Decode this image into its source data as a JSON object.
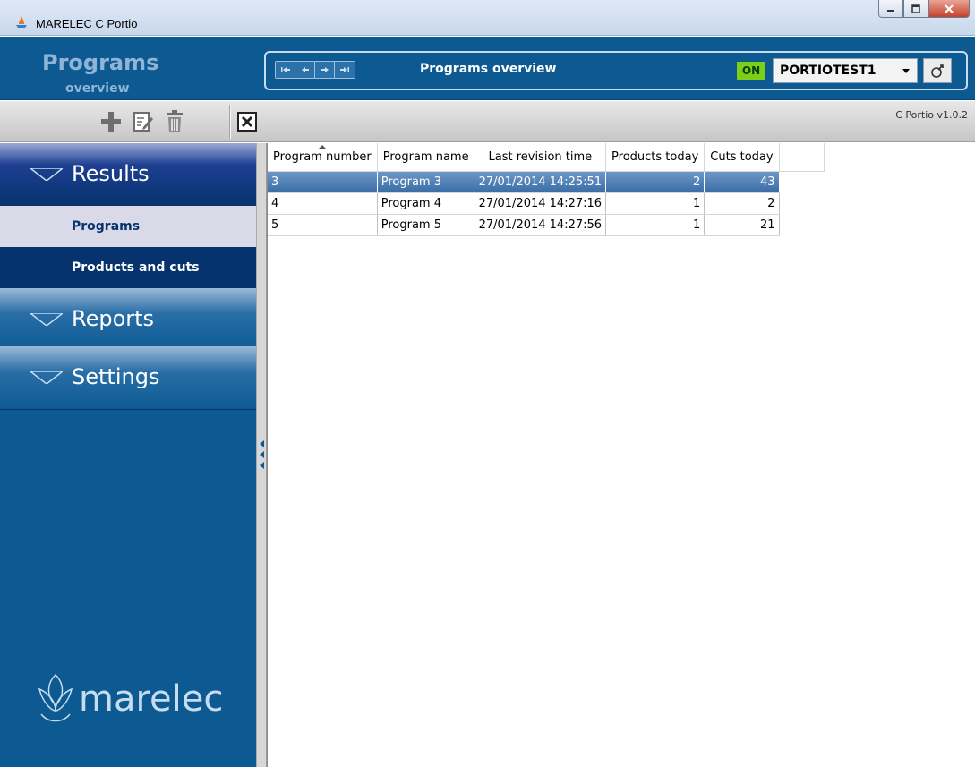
{
  "window": {
    "title": "MARELEC C Portio",
    "controls": [
      "minimize",
      "maximize",
      "close"
    ]
  },
  "header": {
    "title": "Programs",
    "subtitle": "overview",
    "nav_label": "Programs overview",
    "status_badge": "ON",
    "machine": "PORTIOTEST1"
  },
  "toolbar": {
    "icons": [
      "plus-icon",
      "edit-icon",
      "trash-icon",
      "close-box-icon"
    ],
    "version": "C Portio v1.0.2"
  },
  "sidebar": {
    "sections": [
      {
        "label": "Results",
        "items": [
          {
            "label": "Programs",
            "selected": true
          },
          {
            "label": "Products and cuts",
            "selected": false
          }
        ]
      },
      {
        "label": "Reports"
      },
      {
        "label": "Settings"
      }
    ],
    "logo_text": "marelec"
  },
  "grid": {
    "columns": [
      "Program number",
      "Program name",
      "Last revision time",
      "Products today",
      "Cuts today"
    ],
    "rows": [
      {
        "number": "3",
        "name": "Program 3",
        "revision": "27/01/2014 14:25:51",
        "products": "2",
        "cuts": "43",
        "selected": true
      },
      {
        "number": "4",
        "name": "Program 4",
        "revision": "27/01/2014 14:27:16",
        "products": "1",
        "cuts": "2",
        "selected": false
      },
      {
        "number": "5",
        "name": "Program 5",
        "revision": "27/01/2014 14:27:56",
        "products": "1",
        "cuts": "21",
        "selected": false
      }
    ]
  },
  "colors": {
    "brand_blue": "#0d5a93",
    "dark_blue": "#06336e",
    "status_green": "#7ccf16",
    "selection": "#3b6ea6"
  }
}
